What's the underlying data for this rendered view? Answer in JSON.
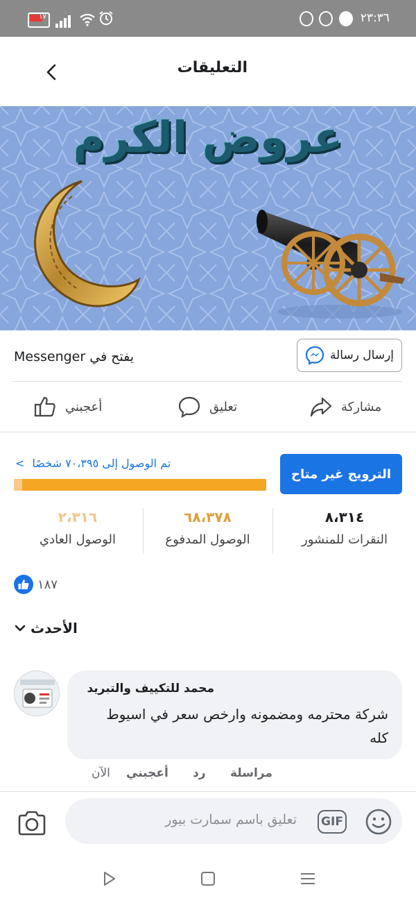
{
  "status_bar": {
    "time": "٢٣:٣٦",
    "battery": "١٧"
  },
  "header": {
    "title": "التعليقات"
  },
  "banner": {
    "title": "عروض الكرم"
  },
  "messenger": {
    "send_label": "إرسال رسالة",
    "opens_in": "يفتح في Messenger"
  },
  "post_actions": {
    "share": "مشاركة",
    "comment": "تعليق",
    "like": "أعجبني"
  },
  "promotion": {
    "button_label": "الترويج غير متاح",
    "reach_text": "تم الوصول إلى ٧٠،٣٩٥ شخصًا",
    "reach_chevron": "<"
  },
  "stats": [
    {
      "value": "٨،٣١٤",
      "label": "النقرات للمنشور",
      "color": "#1c1e21"
    },
    {
      "value": "٦٨،٣٧٨",
      "label": "الوصول المدفوع",
      "color": "#e0a03a"
    },
    {
      "value": "٢،٣١٦",
      "label": "الوصول العادي",
      "color": "#f0c68a"
    }
  ],
  "reactions": {
    "count": "١٨٧"
  },
  "sort": {
    "label": "الأحدث"
  },
  "comment": {
    "author": "محمد للتكييف والتبريد",
    "text": "شركة محترمه ومضمونه وارخص سعر في اسيوط كله",
    "actions": {
      "message": "مراسلة",
      "reply": "رد",
      "like": "أعجبني",
      "time": "الآن"
    }
  },
  "composer": {
    "placeholder": "تعليق باسم سمارت بيور",
    "gif_label": "GIF"
  },
  "colors": {
    "brand_blue": "#1b74e4",
    "progress_orange": "#f5a623"
  }
}
